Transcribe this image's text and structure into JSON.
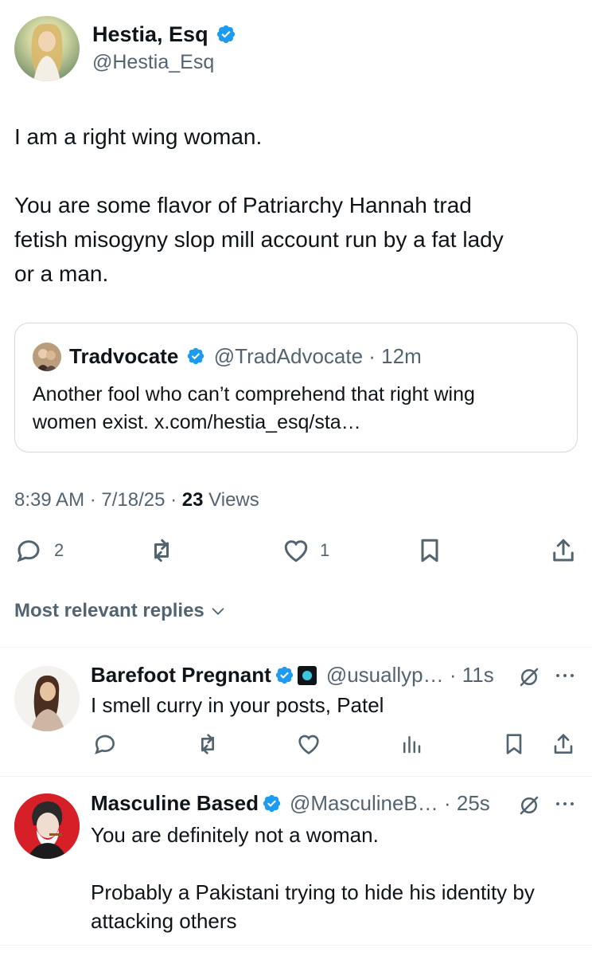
{
  "post": {
    "author_name": "Hestia, Esq",
    "author_handle": "@Hestia_Esq",
    "body_lines": [
      "I am a right wing woman.",
      "You are some flavor of Patriarchy Hannah trad",
      "fetish misogyny slop mill account run by a fat lady",
      "or a man."
    ],
    "quote": {
      "author_name": "Tradvocate",
      "author_handle": "@TradAdvocate",
      "time": "12m",
      "line1": "Another fool who can’t comprehend that right wing",
      "line2": "women exist. x.com/hestia_esq/sta…"
    },
    "time": "8:39 AM",
    "date": "7/18/25",
    "views_count": "23",
    "views_label": "Views",
    "actions": {
      "replies": "2",
      "likes": "1"
    }
  },
  "replies_sort_label": "Most relevant replies",
  "replies": [
    {
      "author_name": "Barefoot Pregnant",
      "author_handle": "@usuallyp…",
      "time": "11s",
      "text": "I smell curry in your posts, Patel"
    },
    {
      "author_name": "Masculine Based",
      "author_handle": "@MasculineB…",
      "time": "25s",
      "text_line1": "You are definitely not a woman.",
      "text_line2": "Probably a Pakistani trying to hide his identity by",
      "text_line3": "attacking others"
    }
  ],
  "colors": {
    "text": "#0f1419",
    "secondary": "#536471",
    "verified": "#1d9bf0",
    "border": "#cfd9de"
  },
  "icons": [
    "verified-badge-icon",
    "reply-icon",
    "retweet-icon",
    "like-icon",
    "bookmark-icon",
    "share-icon",
    "views-icon",
    "chevron-down-icon",
    "grok-icon",
    "more-icon"
  ]
}
